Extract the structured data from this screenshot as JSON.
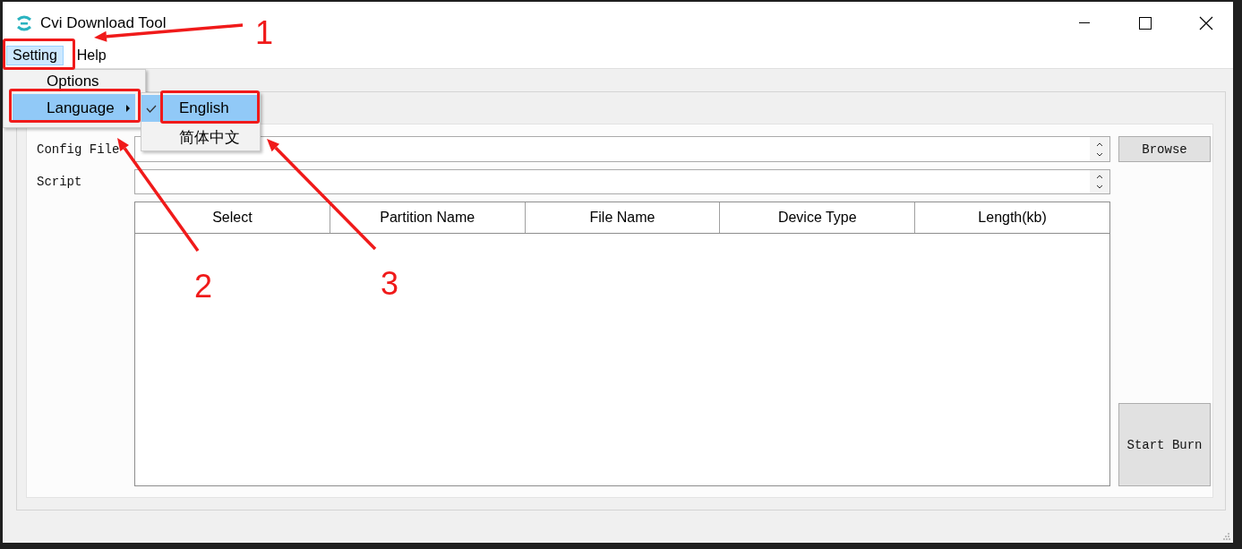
{
  "window": {
    "title": "Cvi Download Tool"
  },
  "menu_bar": [
    {
      "label": "Setting",
      "selected": true
    },
    {
      "label": "Help",
      "selected": false
    }
  ],
  "dropdown": [
    {
      "label": "Options",
      "selected": false,
      "submenu": false
    },
    {
      "label": "Language",
      "selected": true,
      "submenu": true
    }
  ],
  "submenu": [
    {
      "label": "English",
      "checked": true,
      "selected": true
    },
    {
      "label": "简体中文",
      "checked": false,
      "selected": false
    }
  ],
  "form": {
    "fields": [
      {
        "label": "Config File"
      },
      {
        "label": "Script"
      }
    ],
    "browse_button": "Browse",
    "start_button": "Start Burn"
  },
  "table": {
    "columns": [
      "Select",
      "Partition Name",
      "File Name",
      "Device Type",
      "Length(kb)"
    ]
  },
  "annotations": [
    {
      "label": "1"
    },
    {
      "label": "2"
    },
    {
      "label": "3"
    }
  ]
}
